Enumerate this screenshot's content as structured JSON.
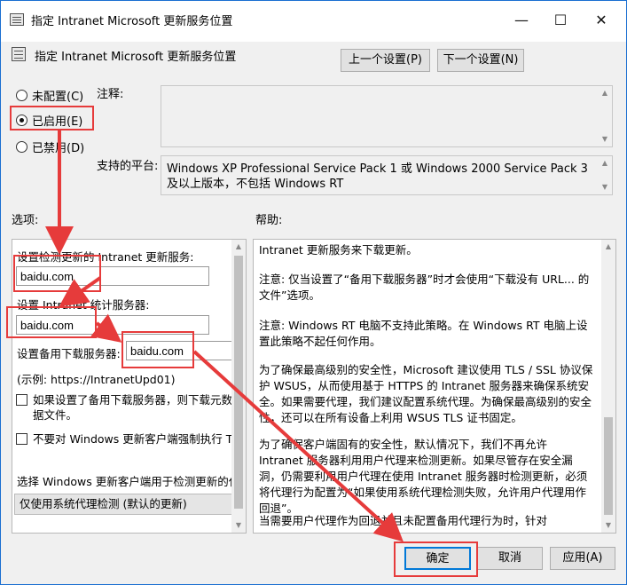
{
  "window": {
    "title": "指定 Intranet Microsoft 更新服务位置",
    "minimize_glyph": "—",
    "maximize_glyph": "☐",
    "close_glyph": "✕"
  },
  "header": {
    "policy_name": "指定 Intranet Microsoft 更新服务位置",
    "prev_button": "上一个设置(P)",
    "next_button": "下一个设置(N)"
  },
  "state": {
    "not_configured": "未配置(C)",
    "enabled": "已启用(E)",
    "disabled": "已禁用(D)",
    "selected": "enabled"
  },
  "comment": {
    "label": "注释:",
    "value": ""
  },
  "platform": {
    "label": "支持的平台:",
    "text": "Windows XP Professional Service Pack 1 或 Windows 2000 Service Pack 3 及以上版本，不包括 Windows RT"
  },
  "options": {
    "label": "选项:",
    "update_server_label": "设置检测更新的 Intranet 更新服务:",
    "update_server_value": "baidu.com",
    "stats_server_label": "设置 Intranet 统计服务器:",
    "stats_server_value": "baidu.com",
    "alt_download_label": "设置备用下载服务器:",
    "alt_download_value": "baidu.com",
    "example": "(示例:   https://IntranetUpd01)",
    "check1": "如果设置了备用下载服务器，则下载元数据文件。",
    "check2": "不要对 Windows 更新客户端强制执行 TLS 证书固定",
    "proxy_label": "选择 Windows 更新客户端用于检测更新的代理行为",
    "proxy_value": "仅使用系统代理检测 (默认的更新)"
  },
  "help": {
    "label": "帮助:",
    "paragraphs": [
      "Intranet 更新服务来下载更新。",
      "        注意: 仅当设置了“备用下载服务器”时才会使用“下载没有 URL... 的文件”选项。",
      "        注意: Windows RT 电脑不支持此策略。在 Windows RT 电脑上设置此策略不起任何作用。",
      "        为了确保最高级别的安全性，Microsoft 建议使用 TLS / SSL 协议保护 WSUS，从而使用基于 HTTPS 的 Intranet 服务器来确保系统安全。如果需要代理，我们建议配置系统代理。为确保最高级别的安全性，还可以在所有设备上利用 WSUS TLS 证书固定。",
      "        为了确保客户端固有的安全性，默认情况下，我们不再允许 Intranet 服务器利用用户代理来检测更新。如果尽管存在安全漏洞，仍需要利用用户代理在使用 Intranet 服务器时检测更新，必须将代理行为配置为“如果使用系统代理检测失败，允许用户代理用作回退”。",
      "        当需要用户代理作为回退并且未配置备用代理行为时，针对"
    ]
  },
  "footer": {
    "ok": "确定",
    "cancel": "取消",
    "apply": "应用(A)"
  },
  "colors": {
    "annotation": "#e63b3b",
    "title_border": "#1a6fd1",
    "ok_border": "#0078d7"
  }
}
